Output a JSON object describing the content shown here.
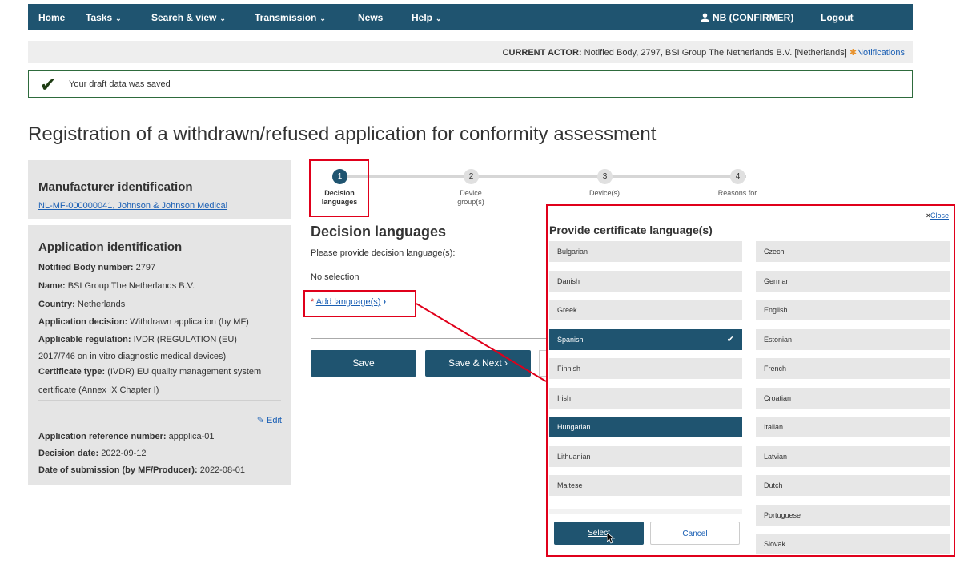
{
  "nav": {
    "home": "Home",
    "tasks": "Tasks",
    "search": "Search & view",
    "transmission": "Transmission",
    "news": "News",
    "help": "Help",
    "chevron": "⌄",
    "user_icon": "user-icon",
    "user": "NB (CONFIRMER)",
    "logout": "Logout"
  },
  "actor": {
    "label": "CURRENT ACTOR:",
    "value": "Notified Body, 2797, BSI Group The Netherlands B.V. [Netherlands]",
    "notifications": "Notifications"
  },
  "success": {
    "message": "Your draft data was saved"
  },
  "page_title": "Registration of a withdrawn/refused application for conformity assessment",
  "manufacturer": {
    "title": "Manufacturer identification",
    "link": "NL-MF-000000041, Johnson & Johnson Medical"
  },
  "application": {
    "title": "Application identification",
    "nb_number_label": "Notified Body number:",
    "nb_number": "2797",
    "name_label": "Name:",
    "name": "BSI Group The Netherlands B.V.",
    "country_label": "Country:",
    "country": "Netherlands",
    "decision_label": "Application decision:",
    "decision": "Withdrawn application (by MF)",
    "regulation_label": "Applicable regulation:",
    "regulation": "IVDR (REGULATION (EU)",
    "regulation_cont": "2017/746 on in vitro diagnostic medical devices)",
    "cert_label": "Certificate type:",
    "cert": "(IVDR) EU quality management system",
    "cert_cont": "certificate (Annex IX Chapter I)",
    "edit": "Edit",
    "ref_label": "Application reference number:",
    "ref": "appplica-01",
    "decision_date_label": "Decision date:",
    "decision_date": "2022-09-12",
    "submission_label": "Date of submission (by MF/Producer):",
    "submission": "2022-08-01"
  },
  "steps": [
    {
      "num": "1",
      "label1": "Decision",
      "label2": "languages"
    },
    {
      "num": "2",
      "label1": "Device",
      "label2": "group(s)"
    },
    {
      "num": "3",
      "label1": "Device(s)",
      "label2": ""
    },
    {
      "num": "4",
      "label1": "Reasons for",
      "label2": ""
    }
  ],
  "form": {
    "heading": "Decision languages",
    "prompt": "Please provide decision language(s):",
    "no_selection": "No selection",
    "required_mark": "*",
    "add_languages": "Add language(s)",
    "save": "Save",
    "save_next": "Save & Next"
  },
  "modal": {
    "close": "Close",
    "title": "Provide certificate language(s)",
    "left_languages": [
      "Bulgarian",
      "Danish",
      "Greek",
      "Spanish",
      "Finnish",
      "Irish",
      "Hungarian",
      "Lithuanian",
      "Maltese"
    ],
    "right_languages": [
      "Czech",
      "German",
      "English",
      "Estonian",
      "French",
      "Croatian",
      "Italian",
      "Latvian",
      "Dutch",
      "Portuguese",
      "Slovak"
    ],
    "selected": [
      "Spanish",
      "Hungarian"
    ],
    "select": "Select",
    "cancel": "Cancel"
  },
  "colors": {
    "primary": "#1f5470",
    "highlight": "#e0001b",
    "link": "#1a5fb4",
    "panel": "#e5e5e5"
  }
}
